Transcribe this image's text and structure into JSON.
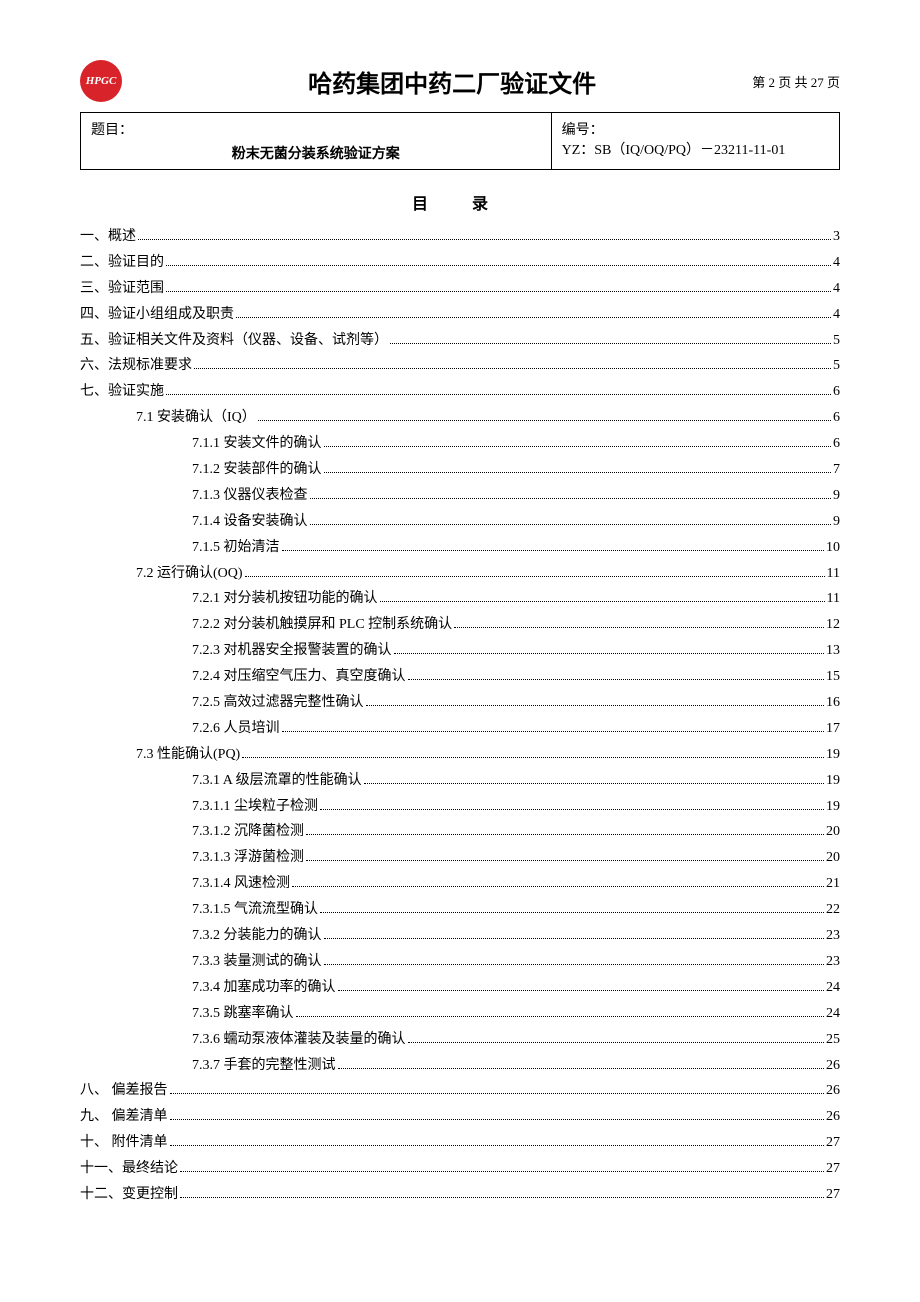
{
  "header": {
    "logo_text": "HPGC",
    "title": "哈药集团中药二厂验证文件",
    "page_label": "第 2 页 共 27 页"
  },
  "info": {
    "topic_label": "题目：",
    "subject": "粉末无菌分装系统验证方案",
    "number_label": "编号：",
    "number_value": "YZ：SB（IQ/OQ/PQ）－23211-11-01"
  },
  "toc_heading": "目 录",
  "toc": [
    {
      "level": 0,
      "label": "一、概述",
      "page": "3"
    },
    {
      "level": 0,
      "label": "二、验证目的",
      "page": "4"
    },
    {
      "level": 0,
      "label": "三、验证范围",
      "page": "4"
    },
    {
      "level": 0,
      "label": "四、验证小组组成及职责",
      "page": "4"
    },
    {
      "level": 0,
      "label": "五、验证相关文件及资料（仪器、设备、试剂等）",
      "page": "5"
    },
    {
      "level": 0,
      "label": "六、法规标准要求",
      "page": "5"
    },
    {
      "level": 0,
      "label": "七、验证实施",
      "page": "6"
    },
    {
      "level": 1,
      "label": "7.1 安装确认（IQ）",
      "page": "6"
    },
    {
      "level": 2,
      "label": "7.1.1 安装文件的确认",
      "page": "6"
    },
    {
      "level": 2,
      "label": "7.1.2 安装部件的确认",
      "page": "7"
    },
    {
      "level": 2,
      "label": "7.1.3 仪器仪表检查",
      "page": "9"
    },
    {
      "level": 2,
      "label": "7.1.4 设备安装确认",
      "page": "9"
    },
    {
      "level": 2,
      "label": "7.1.5 初始清洁",
      "page": "10"
    },
    {
      "level": 1,
      "label": "7.2 运行确认(OQ)",
      "page": "11"
    },
    {
      "level": 2,
      "label": "7.2.1 对分装机按钮功能的确认",
      "page": "11"
    },
    {
      "level": 2,
      "label": "7.2.2 对分装机触摸屏和 PLC 控制系统确认",
      "page": "12"
    },
    {
      "level": 2,
      "label": "7.2.3 对机器安全报警装置的确认",
      "page": "13"
    },
    {
      "level": 2,
      "label": "7.2.4 对压缩空气压力、真空度确认",
      "page": "15"
    },
    {
      "level": 2,
      "label": "7.2.5 高效过滤器完整性确认",
      "page": "16"
    },
    {
      "level": 2,
      "label": "7.2.6 人员培训",
      "page": "17"
    },
    {
      "level": 1,
      "label": "7.3 性能确认(PQ)",
      "page": "19"
    },
    {
      "level": 2,
      "label": "7.3.1 A 级层流罩的性能确认",
      "page": "19"
    },
    {
      "level": 2,
      "label": "7.3.1.1 尘埃粒子检测",
      "page": "19"
    },
    {
      "level": 2,
      "label": "7.3.1.2 沉降菌检测",
      "page": "20"
    },
    {
      "level": 2,
      "label": "7.3.1.3 浮游菌检测",
      "page": "20"
    },
    {
      "level": 2,
      "label": "7.3.1.4 风速检测",
      "page": "21"
    },
    {
      "level": 2,
      "label": "7.3.1.5 气流流型确认",
      "page": "22"
    },
    {
      "level": 2,
      "label": "7.3.2 分装能力的确认",
      "page": "23"
    },
    {
      "level": 2,
      "label": "7.3.3 装量测试的确认",
      "page": "23"
    },
    {
      "level": 2,
      "label": "7.3.4 加塞成功率的确认",
      "page": "24"
    },
    {
      "level": 2,
      "label": "7.3.5 跳塞率确认",
      "page": "24"
    },
    {
      "level": 2,
      "label": "7.3.6 蠕动泵液体灌装及装量的确认",
      "page": "25"
    },
    {
      "level": 2,
      "label": "7.3.7 手套的完整性测试",
      "page": "26"
    },
    {
      "level": 0,
      "label": "八、 偏差报告",
      "page": "26"
    },
    {
      "level": 0,
      "label": "九、 偏差清单",
      "page": "26"
    },
    {
      "level": 0,
      "label": "十、 附件清单",
      "page": "27"
    },
    {
      "level": 0,
      "label": "十一、最终结论",
      "page": "27"
    },
    {
      "level": 0,
      "label": "十二、变更控制",
      "page": "27"
    }
  ]
}
